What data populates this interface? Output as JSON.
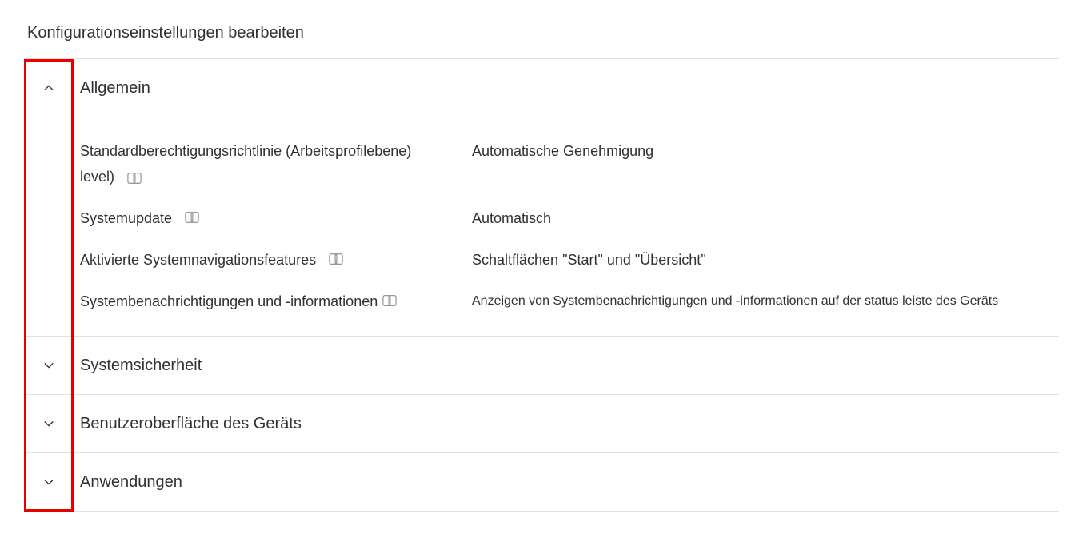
{
  "page": {
    "title": "Konfigurationseinstellungen bearbeiten"
  },
  "sections": {
    "general": {
      "title": "Allgemein",
      "settings": {
        "permission_policy": {
          "label_line1": "Standardberechtigungsrichtlinie (Arbeitsprofilebene)",
          "label_line2": "level)",
          "value": "Automatische Genehmigung"
        },
        "system_update": {
          "label": "Systemupdate",
          "value": "Automatisch"
        },
        "nav_features": {
          "label": "Aktivierte Systemnavigationsfeatures",
          "value": "Schaltflächen \"Start\" und \"Übersicht\""
        },
        "system_notifications": {
          "label": "Systembenachrichtigungen und -informationen",
          "value": "Anzeigen von Systembenachrichtigungen und -informationen auf der status leiste des Geräts"
        }
      }
    },
    "system_security": {
      "title": "Systemsicherheit"
    },
    "device_ui": {
      "title": "Benutzeroberfläche des Geräts"
    },
    "applications": {
      "title": "Anwendungen"
    }
  }
}
